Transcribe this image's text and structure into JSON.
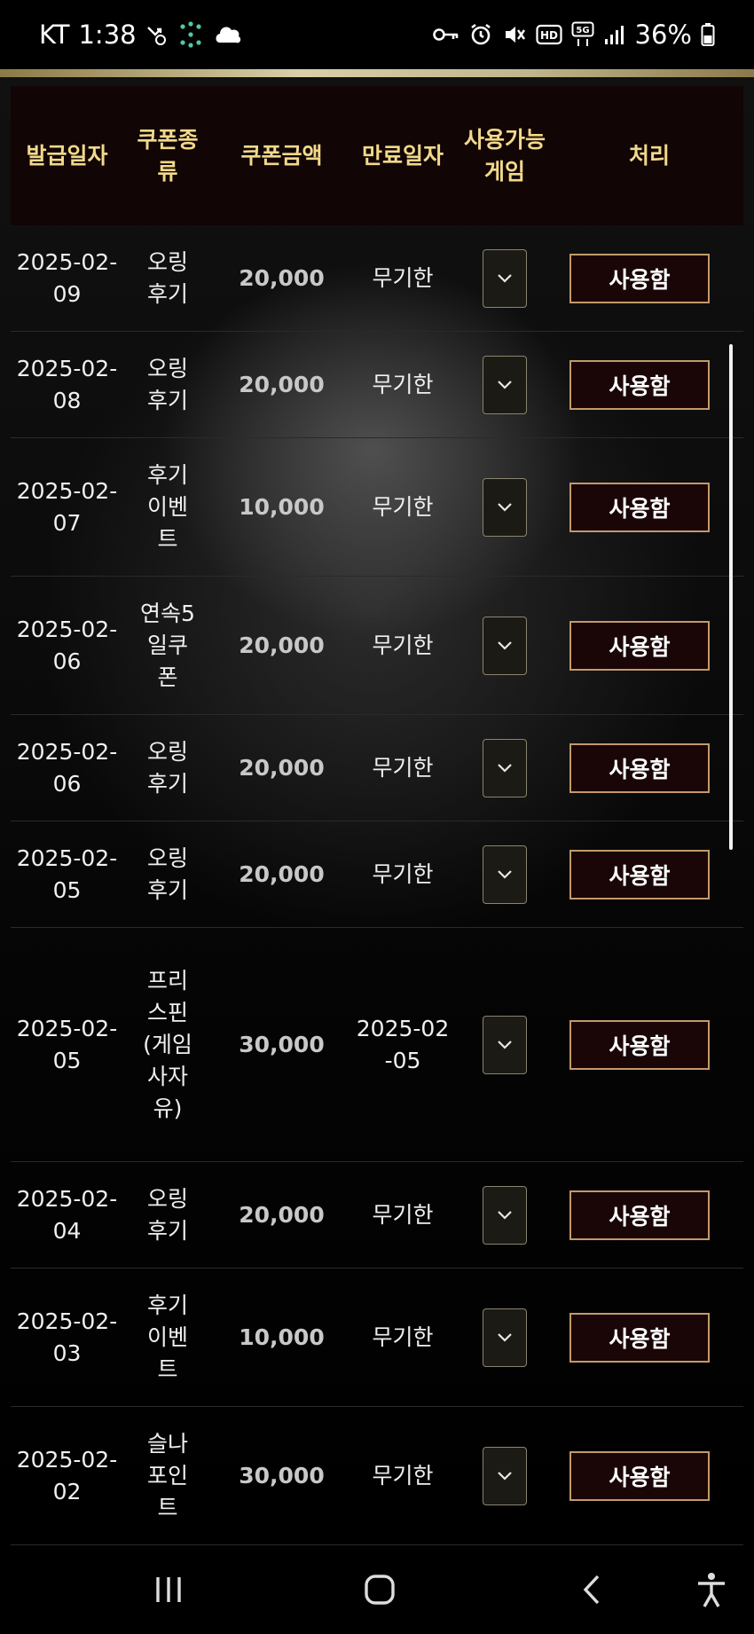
{
  "status_bar": {
    "carrier": "KT",
    "time": "1:38",
    "battery": "36%"
  },
  "table": {
    "headers": {
      "issue_date": "발급일자",
      "coupon_type": "쿠폰종류",
      "coupon_amount": "쿠폰금액",
      "expiry_date": "만료일자",
      "available_games": "사용가능게임",
      "action": "처리"
    },
    "rows": [
      {
        "issue_date": "2025-02-09",
        "coupon_type": "오링후기",
        "coupon_amount": "20,000",
        "expiry_date": "무기한",
        "action": "사용함"
      },
      {
        "issue_date": "2025-02-08",
        "coupon_type": "오링후기",
        "coupon_amount": "20,000",
        "expiry_date": "무기한",
        "action": "사용함"
      },
      {
        "issue_date": "2025-02-07",
        "coupon_type": "후기이벤트",
        "coupon_amount": "10,000",
        "expiry_date": "무기한",
        "action": "사용함"
      },
      {
        "issue_date": "2025-02-06",
        "coupon_type": "연속5일쿠폰",
        "coupon_amount": "20,000",
        "expiry_date": "무기한",
        "action": "사용함"
      },
      {
        "issue_date": "2025-02-06",
        "coupon_type": "오링후기",
        "coupon_amount": "20,000",
        "expiry_date": "무기한",
        "action": "사용함"
      },
      {
        "issue_date": "2025-02-05",
        "coupon_type": "오링후기",
        "coupon_amount": "20,000",
        "expiry_date": "무기한",
        "action": "사용함"
      },
      {
        "issue_date": "2025-02-05",
        "coupon_type": "프리스핀(게임사자유)",
        "coupon_amount": "30,000",
        "expiry_date": "2025-02-05",
        "action": "사용함"
      },
      {
        "issue_date": "2025-02-04",
        "coupon_type": "오링후기",
        "coupon_amount": "20,000",
        "expiry_date": "무기한",
        "action": "사용함"
      },
      {
        "issue_date": "2025-02-03",
        "coupon_type": "후기이벤트",
        "coupon_amount": "10,000",
        "expiry_date": "무기한",
        "action": "사용함"
      },
      {
        "issue_date": "2025-02-02",
        "coupon_type": "슬나포인트",
        "coupon_amount": "30,000",
        "expiry_date": "무기한",
        "action": "사용함"
      }
    ]
  },
  "colors": {
    "header_text": "#f2d98a",
    "button_border": "#c29a6a",
    "button_bg": "#1a0507"
  },
  "icons": [
    "key-icon",
    "alarm-icon",
    "mute-icon",
    "hd-icon",
    "5g-icon",
    "signal-icon",
    "battery-icon",
    "chevron-down-icon",
    "recent-apps-icon",
    "home-icon",
    "back-icon",
    "accessibility-icon"
  ]
}
